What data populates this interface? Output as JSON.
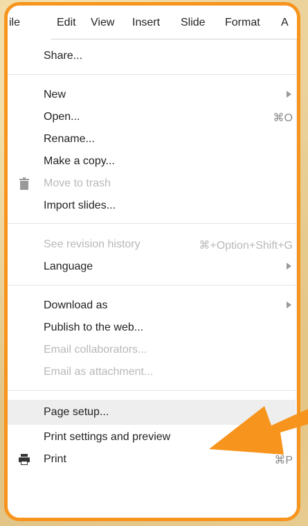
{
  "menubar": {
    "items": [
      "ile",
      "Edit",
      "View",
      "Insert",
      "Slide",
      "Format",
      "A"
    ]
  },
  "file_menu": {
    "share": "Share...",
    "new": "New",
    "open": "Open...",
    "open_shortcut": "⌘O",
    "rename": "Rename...",
    "make_copy": "Make a copy...",
    "move_to_trash": "Move to trash",
    "import_slides": "Import slides...",
    "revision_history": "See revision history",
    "revision_history_shortcut": "⌘+Option+Shift+G",
    "language": "Language",
    "download_as": "Download as",
    "publish": "Publish to the web...",
    "email_collaborators": "Email collaborators...",
    "email_attachment": "Email as attachment...",
    "page_setup": "Page setup...",
    "print_settings": "Print settings and preview",
    "print": "Print",
    "print_shortcut": "⌘P"
  },
  "colors": {
    "highlight_frame": "#f7941d",
    "annotation_arrow": "#f7941d",
    "hover_row": "#eeeeee",
    "disabled_text": "#b8b8b8"
  },
  "icons": {
    "trash": "trash-icon",
    "print": "printer-icon",
    "submenu": "chevron-right-icon",
    "annotation": "arrow-icon"
  }
}
